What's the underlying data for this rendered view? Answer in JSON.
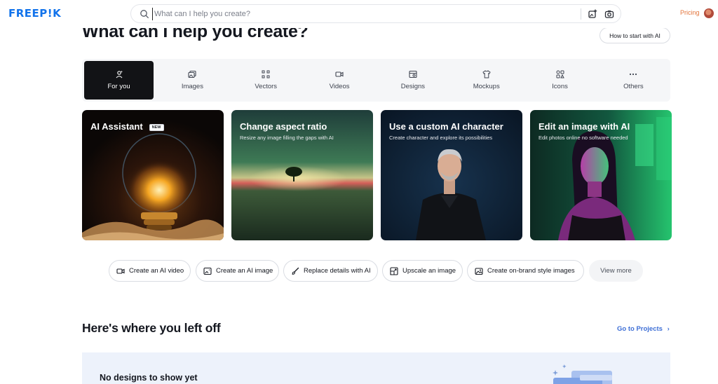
{
  "header": {
    "logo_text": "FREEP!K",
    "search_placeholder": "What can I help you create?",
    "pricing_label": "Pricing",
    "brand_color": "#1273eb",
    "pricing_color": "#e3743a"
  },
  "hero": {
    "title": "What can I help you create?",
    "how_to_button": "How to start with AI"
  },
  "tabs": [
    {
      "label": "For you",
      "icon": "sparkle-person-icon",
      "active": true
    },
    {
      "label": "Images",
      "icon": "images-icon",
      "active": false
    },
    {
      "label": "Vectors",
      "icon": "vectors-icon",
      "active": false
    },
    {
      "label": "Videos",
      "icon": "video-icon",
      "active": false
    },
    {
      "label": "Designs",
      "icon": "designs-icon",
      "active": false
    },
    {
      "label": "Mockups",
      "icon": "mockup-shirt-icon",
      "active": false
    },
    {
      "label": "Icons",
      "icon": "icons-grid-icon",
      "active": false
    },
    {
      "label": "Others",
      "icon": "more-dots-icon",
      "active": false
    }
  ],
  "cards": [
    {
      "title": "AI Assistant",
      "badge": "NEW",
      "subtitle": ""
    },
    {
      "title": "Change aspect ratio",
      "subtitle": "Resize any image filling the gaps with AI"
    },
    {
      "title": "Use a custom AI character",
      "subtitle": "Create character and explore its possibilities"
    },
    {
      "title": "Edit an image with AI",
      "subtitle": "Edit photos online no software needed"
    }
  ],
  "quick_actions": [
    {
      "label": "Create an AI video",
      "icon": "video-icon"
    },
    {
      "label": "Create an AI image",
      "icon": "ai-image-icon"
    },
    {
      "label": "Replace details with AI",
      "icon": "brush-icon"
    },
    {
      "label": "Upscale an image",
      "icon": "upscale-icon"
    },
    {
      "label": "Create on-brand style images",
      "icon": "style-image-icon"
    }
  ],
  "view_more_label": "View more",
  "left_off": {
    "title": "Here's where you left off",
    "go_to_projects": "Go to Projects",
    "empty_text": "No designs to show yet"
  }
}
